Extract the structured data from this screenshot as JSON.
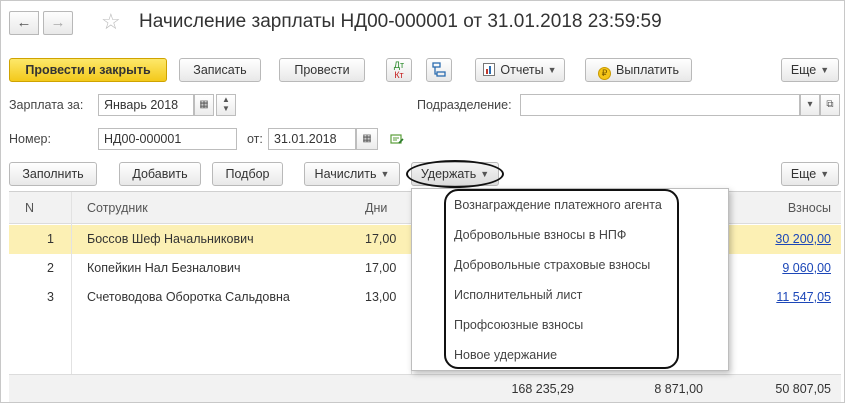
{
  "window": {
    "title": "Начисление зарплаты НД00-000001 от 31.01.2018 23:59:59",
    "back_glyph": "←",
    "forward_glyph": "→",
    "star_glyph": "☆"
  },
  "toolbar": {
    "post_close_label": "Провести и закрыть",
    "save_label": "Записать",
    "post_label": "Провести",
    "dtkt_top": "Дт",
    "dtkt_bottom": "Кт",
    "reports_label": "Отчеты",
    "pay_label": "Выплатить",
    "more_label": "Еще"
  },
  "form": {
    "salary_for_label": "Зарплата за:",
    "salary_for_value": "Январь 2018",
    "department_label": "Подразделение:",
    "department_value": "",
    "number_label": "Номер:",
    "number_value": "НД00-000001",
    "from_label": "от:",
    "from_value": "31.01.2018"
  },
  "table_toolbar": {
    "fill_label": "Заполнить",
    "add_label": "Добавить",
    "select_label": "Подбор",
    "accrue_label": "Начислить",
    "withhold_label": "Удержать",
    "more_label": "Еще"
  },
  "table": {
    "headers": {
      "n": "N",
      "employee": "Сотрудник",
      "days": "Дни",
      "contrib": "Взносы"
    },
    "rows": [
      {
        "n": "1",
        "employee": "Боссов Шеф Начальникович",
        "days": "17,00",
        "contrib": "30 200,00"
      },
      {
        "n": "2",
        "employee": "Копейкин Нал Безналович",
        "days": "17,00",
        "contrib": "9 060,00"
      },
      {
        "n": "3",
        "employee": "Счетоводова Оборотка Сальдовна",
        "days": "13,00",
        "contrib": "11 547,05"
      }
    ],
    "totals": {
      "col1": "168 235,29",
      "col2": "8 871,00",
      "contrib": "50 807,05"
    }
  },
  "withhold_menu": {
    "items": [
      "Вознаграждение платежного агента",
      "Добровольные взносы в НПФ",
      "Добровольные страховые взносы",
      "Исполнительный лист",
      "Профсоюзные взносы",
      "Новое удержание"
    ]
  },
  "colors": {
    "primary_button": "#f3c91b",
    "selected_row": "#fcf0b4",
    "link": "#1c47b8"
  }
}
